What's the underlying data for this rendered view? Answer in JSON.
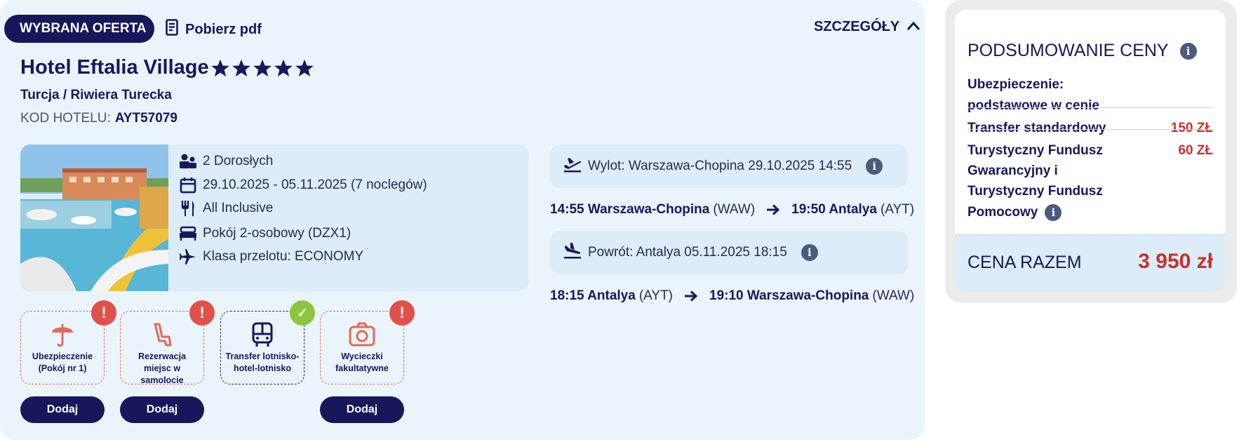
{
  "offer": {
    "badge": "WYBRANA OFERTA",
    "pdf_label": "Pobierz pdf",
    "details_label": "SZCZEGÓŁY",
    "hotel_name": "Hotel Eftalia Village",
    "stars": 5,
    "region": "Turcja / Riwiera Turecka",
    "hotel_code_label": "KOD HOTELU:",
    "hotel_code": "AYT57079",
    "features": {
      "guests": "2 Dorosłych",
      "dates": "29.10.2025 - 05.11.2025 (7 noclegów)",
      "board": "All Inclusive",
      "room": "Pokój 2-osobowy (DZX1)",
      "flight_class": "Klasa przelotu: ECONOMY"
    },
    "extras": [
      {
        "label": "Ubezpieczenie (Pokój nr 1)",
        "status": "!",
        "icon": "umbrella-icon",
        "button": "Dodaj"
      },
      {
        "label": "Rezerwacja miejsc w samolocie",
        "status": "!",
        "icon": "seat-icon",
        "button": "Dodaj"
      },
      {
        "label": "Transfer lotnisko-hotel-lotnisko",
        "status": "✓",
        "icon": "bus-icon"
      },
      {
        "label": "Wycieczki fakultatywne",
        "status": "!",
        "icon": "camera-icon",
        "button": "Dodaj"
      }
    ],
    "flights": {
      "outbound_head": "Wylot: Warszawa-Chopina 29.10.2025 14:55",
      "outbound_dep": "14:55 Warszawa-Chopina",
      "outbound_dep_code": "(WAW)",
      "outbound_arr": "19:50 Antalya",
      "outbound_arr_code": "(AYT)",
      "return_head": "Powrót: Antalya 05.11.2025 18:15",
      "return_dep": "18:15 Antalya",
      "return_dep_code": "(AYT)",
      "return_arr": "19:10 Warszawa-Chopina",
      "return_arr_code": "(WAW)"
    }
  },
  "summary": {
    "title": "PODSUMOWANIE CENY",
    "insurance_line1": "Ubezpieczenie:",
    "insurance_line2": "podstawowe w cenie",
    "transfer_label": "Transfer standardowy",
    "transfer_price": "150 ZŁ",
    "fund_line1": "Turystyczny Fundusz",
    "fund_line2": "Gwarancyjny i",
    "fund_line3": "Turystyczny Fundusz",
    "fund_line4": "Pomocowy",
    "fund_price": "60 ZŁ",
    "total_label": "CENA RAZEM",
    "total_value": "3 950 zł"
  },
  "colors": {
    "navy": "#17185b",
    "card_bg": "#eaf4fb",
    "panel_bg": "#dcecf8",
    "price_red": "#c8302c",
    "alert_red": "#e2504a",
    "ok_green": "#8cc63f"
  }
}
